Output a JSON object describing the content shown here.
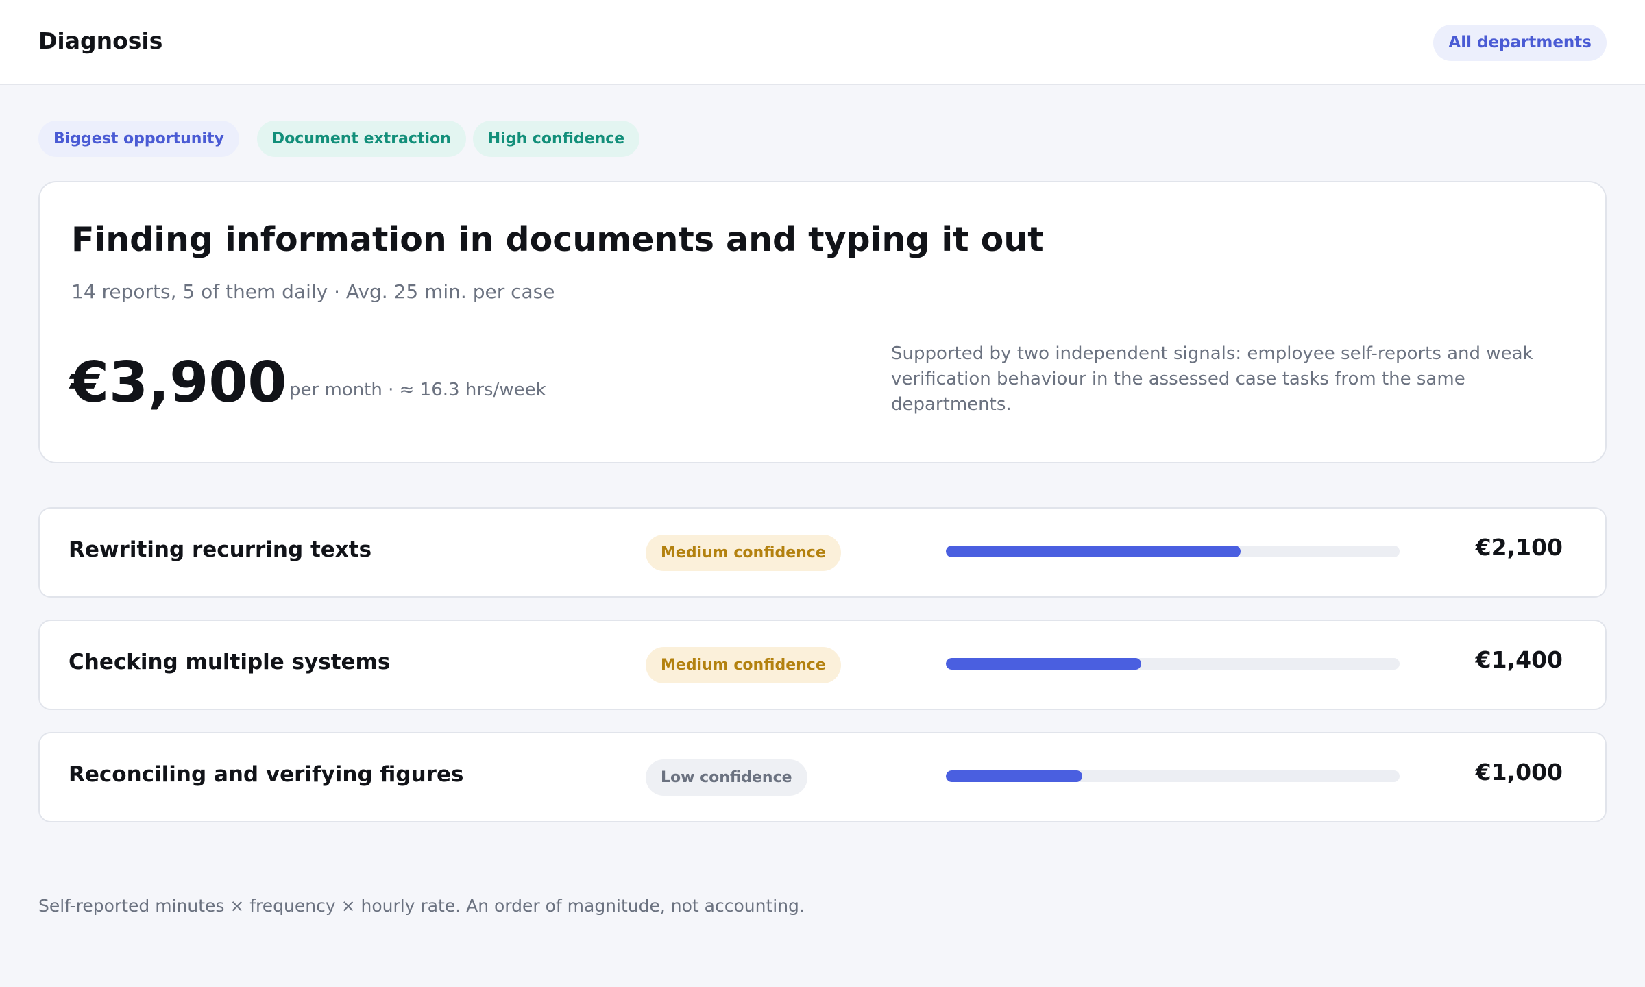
{
  "header": {
    "title": "Diagnosis",
    "department_filter": "All departments"
  },
  "tags": [
    "Biggest opportunity",
    "Document extraction",
    "High confidence"
  ],
  "hero": {
    "title": "Finding information in documents and typing it out",
    "subtitle": "14 reports, 5 of them daily · Avg. 25 min. per case",
    "amount": "€3,900",
    "amount_detail": "per month · ≈ 16.3 hrs/week",
    "note": "Supported by two independent signals: employee self-reports and weak verification behaviour in the assessed case tasks from the same departments."
  },
  "opportunities": [
    {
      "label": "Rewriting recurring texts",
      "confidence": "Medium confidence",
      "confidence_level": "medium",
      "amount": "€2,100",
      "value": 2100
    },
    {
      "label": "Checking multiple systems",
      "confidence": "Medium confidence",
      "confidence_level": "medium",
      "amount": "€1,400",
      "value": 1400
    },
    {
      "label": "Reconciling and verifying figures",
      "confidence": "Low confidence",
      "confidence_level": "low",
      "amount": "€1,000",
      "value": 1000
    }
  ],
  "bar_fraction": [
    0.65,
    0.43,
    0.3
  ],
  "footnote": "Self-reported minutes × frequency × hourly rate. An order of magnitude, not accounting.",
  "colors": {
    "accent": "#4a5fe0",
    "teal": "#138f7a",
    "amber": "#b3810f"
  }
}
